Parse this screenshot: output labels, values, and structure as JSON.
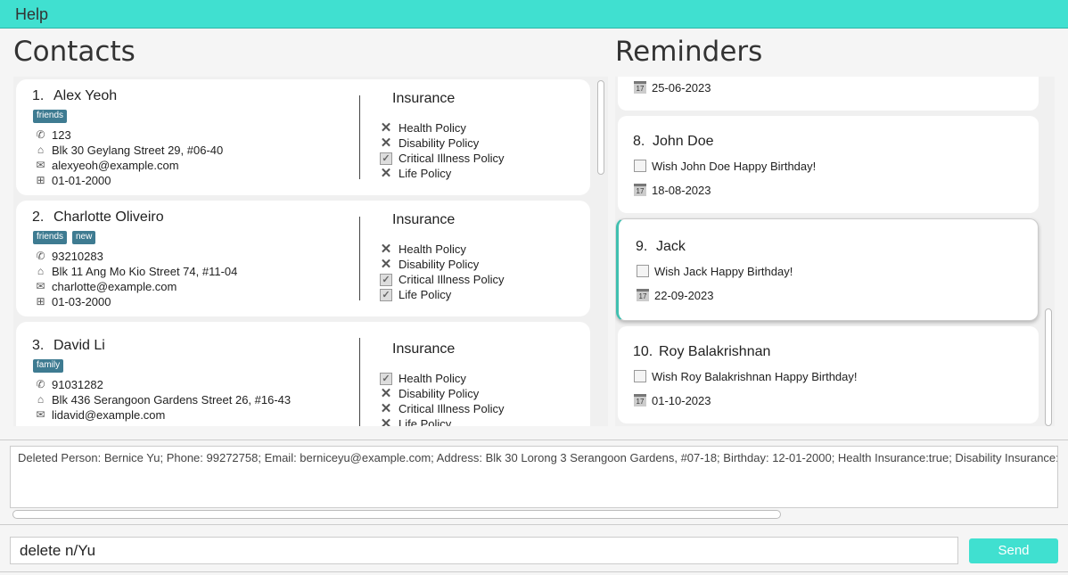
{
  "menu": {
    "help": "Help"
  },
  "contacts": {
    "title": "Contacts",
    "insurance_heading": "Insurance",
    "items": [
      {
        "index": "1.",
        "name": "Alex Yeoh",
        "tags": [
          "friends"
        ],
        "phone": "123",
        "address": "Blk 30 Geylang Street 29, #06-40",
        "email": "alexyeoh@example.com",
        "birthday": "01-01-2000",
        "insurance": [
          {
            "label": "Health Policy",
            "covered": false
          },
          {
            "label": "Disability Policy",
            "covered": false
          },
          {
            "label": "Critical Illness Policy",
            "covered": true
          },
          {
            "label": "Life Policy",
            "covered": false
          }
        ]
      },
      {
        "index": "2.",
        "name": "Charlotte Oliveiro",
        "tags": [
          "friends",
          "new"
        ],
        "phone": "93210283",
        "address": "Blk 11 Ang Mo Kio Street 74, #11-04",
        "email": "charlotte@example.com",
        "birthday": "01-03-2000",
        "insurance": [
          {
            "label": "Health Policy",
            "covered": false
          },
          {
            "label": "Disability Policy",
            "covered": false
          },
          {
            "label": "Critical Illness Policy",
            "covered": true
          },
          {
            "label": "Life Policy",
            "covered": true
          }
        ]
      },
      {
        "index": "3.",
        "name": "David Li",
        "tags": [
          "family"
        ],
        "phone": "91031282",
        "address": "Blk 436 Serangoon Gardens Street 26, #16-43",
        "email": "lidavid@example.com",
        "birthday": "",
        "insurance": [
          {
            "label": "Health Policy",
            "covered": true
          },
          {
            "label": "Disability Policy",
            "covered": false
          },
          {
            "label": "Critical Illness Policy",
            "covered": false
          },
          {
            "label": "Life Policy",
            "covered": false
          }
        ]
      }
    ]
  },
  "reminders": {
    "title": "Reminders",
    "items": [
      {
        "index": "",
        "name": "",
        "message": "",
        "date": "25-06-2023"
      },
      {
        "index": "8.",
        "name": "John Doe",
        "message": "Wish John Doe Happy Birthday!",
        "date": "18-08-2023"
      },
      {
        "index": "9.",
        "name": "Jack",
        "message": "Wish Jack Happy Birthday!",
        "date": "22-09-2023"
      },
      {
        "index": "10.",
        "name": "Roy Balakrishnan",
        "message": "Wish Roy Balakrishnan Happy Birthday!",
        "date": "01-10-2023"
      }
    ]
  },
  "result": {
    "text": "Deleted Person: Bernice Yu; Phone: 99272758; Email: berniceyu@example.com; Address: Blk 30 Lorong 3 Serangoon Gardens, #07-18; Birthday: 12-01-2000; Health Insurance:true; Disability Insurance:false; Cr"
  },
  "command": {
    "value": "delete n/Yu",
    "send_label": "Send"
  },
  "icons": {
    "phone": "phone-icon",
    "address": "house-icon",
    "email": "envelope-icon",
    "birthday": "cake-icon",
    "not_covered": "cross-icon",
    "covered": "checkbox-icon",
    "note": "note-icon",
    "calendar": "calendar-icon"
  },
  "colors": {
    "accent": "#40e0d0",
    "tag": "#3e7b91",
    "selected_border": "#40c0b0"
  }
}
